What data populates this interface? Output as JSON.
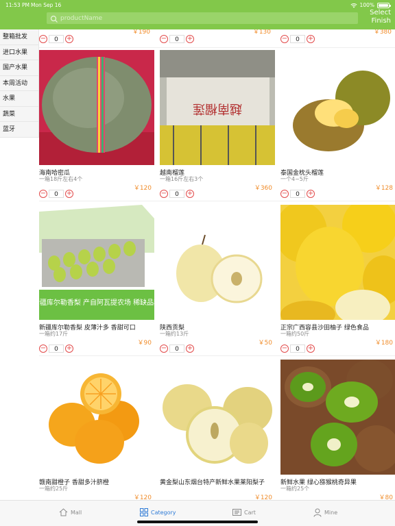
{
  "status": {
    "time": "11:53 PM",
    "date": "Mon Sep 16",
    "battery": "100%",
    "battery_level": 1.0
  },
  "search": {
    "placeholder": "productName"
  },
  "header": {
    "select_label": "Select",
    "finish_label": "Finish"
  },
  "sidebar": {
    "items": [
      {
        "label": "整箱批发"
      },
      {
        "label": "进口水果"
      },
      {
        "label": "国产水果"
      },
      {
        "label": "本周活动"
      },
      {
        "label": "水果"
      },
      {
        "label": "蔬菜"
      },
      {
        "label": "蓝牙"
      }
    ]
  },
  "partial_row": [
    {
      "price": "￥190",
      "qty": "0"
    },
    {
      "price": "￥130",
      "qty": "0"
    },
    {
      "price": "￥380",
      "qty": "0"
    }
  ],
  "products": [
    {
      "name": "海南哈密瓜",
      "desc": "一箱18斤左右4个",
      "price": "￥120",
      "qty": "0",
      "image": "cantaloupe"
    },
    {
      "name": "越南榴莲",
      "desc": "一箱16斤左右3个",
      "price": "￥360",
      "qty": "0",
      "image": "durian-box",
      "img_text": "越南榴莲"
    },
    {
      "name": "泰国金枕头榴莲",
      "desc": "一个4~5斤",
      "price": "￥128",
      "qty": "0",
      "image": "durian"
    },
    {
      "name": "新疆库尔勒香梨 皮薄汁多 香甜可口",
      "desc": "一箱约17斤",
      "price": "￥90",
      "qty": "0",
      "image": "pear-box",
      "img_text": "新疆库尔勒香梨 产自阿瓦提农场 稀缺品种"
    },
    {
      "name": "陕西贡梨",
      "desc": "一箱约13斤",
      "price": "￥50",
      "qty": "0",
      "image": "pear"
    },
    {
      "name": "正宗广西容县沙田柚子 绿色食品",
      "desc": "一箱约50斤",
      "price": "￥180",
      "qty": "0",
      "image": "pomelo"
    },
    {
      "name": "赣南甜橙子 香甜多汁脐橙",
      "desc": "一箱约25斤",
      "price": "￥120",
      "qty": "0",
      "image": "orange"
    },
    {
      "name": "黄金梨山东烟台特产新鲜水果莱阳梨子",
      "desc": "",
      "price": "￥120",
      "qty": "0",
      "image": "golden-pear"
    },
    {
      "name": "新鲜水果 绿心猕猴桃奇异果",
      "desc": "一箱约25个",
      "price": "￥80",
      "qty": "0",
      "image": "kiwi"
    }
  ],
  "tabs": [
    {
      "label": "Mall",
      "icon": "home-icon"
    },
    {
      "label": "Category",
      "icon": "category-icon",
      "active": true
    },
    {
      "label": "Cart",
      "icon": "cart-icon"
    },
    {
      "label": "Mine",
      "icon": "person-icon"
    }
  ],
  "colors": {
    "header": "#82c84a",
    "price": "#f08c2a",
    "active_tab": "#2d7ad6",
    "stepper": "#e24a4a"
  }
}
